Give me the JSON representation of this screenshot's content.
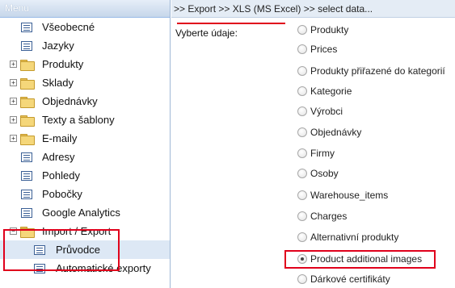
{
  "menu": {
    "title": "Menu",
    "items": [
      {
        "label": "Všeobecné",
        "icon": "document-icon"
      },
      {
        "label": "Jazyky",
        "icon": "document-icon"
      },
      {
        "label": "Produkty",
        "icon": "folder-icon",
        "expander": "+"
      },
      {
        "label": "Sklady",
        "icon": "folder-icon",
        "expander": "+"
      },
      {
        "label": "Objednávky",
        "icon": "folder-icon",
        "expander": "+"
      },
      {
        "label": "Texty a šablony",
        "icon": "folder-icon",
        "expander": "+"
      },
      {
        "label": "E-maily",
        "icon": "folder-icon",
        "expander": "+"
      },
      {
        "label": "Adresy",
        "icon": "document-icon"
      },
      {
        "label": "Pohledy",
        "icon": "document-icon"
      },
      {
        "label": "Pobočky",
        "icon": "document-icon"
      },
      {
        "label": "Google Analytics",
        "icon": "document-icon"
      },
      {
        "label": "Import / Export",
        "icon": "folder-open-icon",
        "expander": "−"
      },
      {
        "label": "Průvodce",
        "icon": "document-icon",
        "selected": true
      },
      {
        "label": "Automatické exporty",
        "icon": "document-icon"
      }
    ]
  },
  "breadcrumb": ">> Export >> XLS (MS Excel) >> select data...",
  "form": {
    "label": "Vyberte údaje:",
    "options": [
      {
        "label": "Produkty",
        "checked": false
      },
      {
        "label": "Prices",
        "checked": false
      },
      {
        "label": "Produkty přiřazené do kategorií",
        "checked": false
      },
      {
        "label": "Kategorie",
        "checked": false
      },
      {
        "label": "Výrobci",
        "checked": false
      },
      {
        "label": "Objednávky",
        "checked": false
      },
      {
        "label": "Firmy",
        "checked": false
      },
      {
        "label": "Osoby",
        "checked": false
      },
      {
        "label": "Warehouse_items",
        "checked": false
      },
      {
        "label": "Charges",
        "checked": false
      },
      {
        "label": "Alternativní produkty",
        "checked": false
      },
      {
        "label": "Product additional images",
        "checked": true
      },
      {
        "label": "Dárkové certifikáty",
        "checked": false
      }
    ]
  },
  "colors": {
    "annotation_red": "#e0001b",
    "header_blue": "#c6d6ea",
    "selected_row": "#dde8f5"
  }
}
